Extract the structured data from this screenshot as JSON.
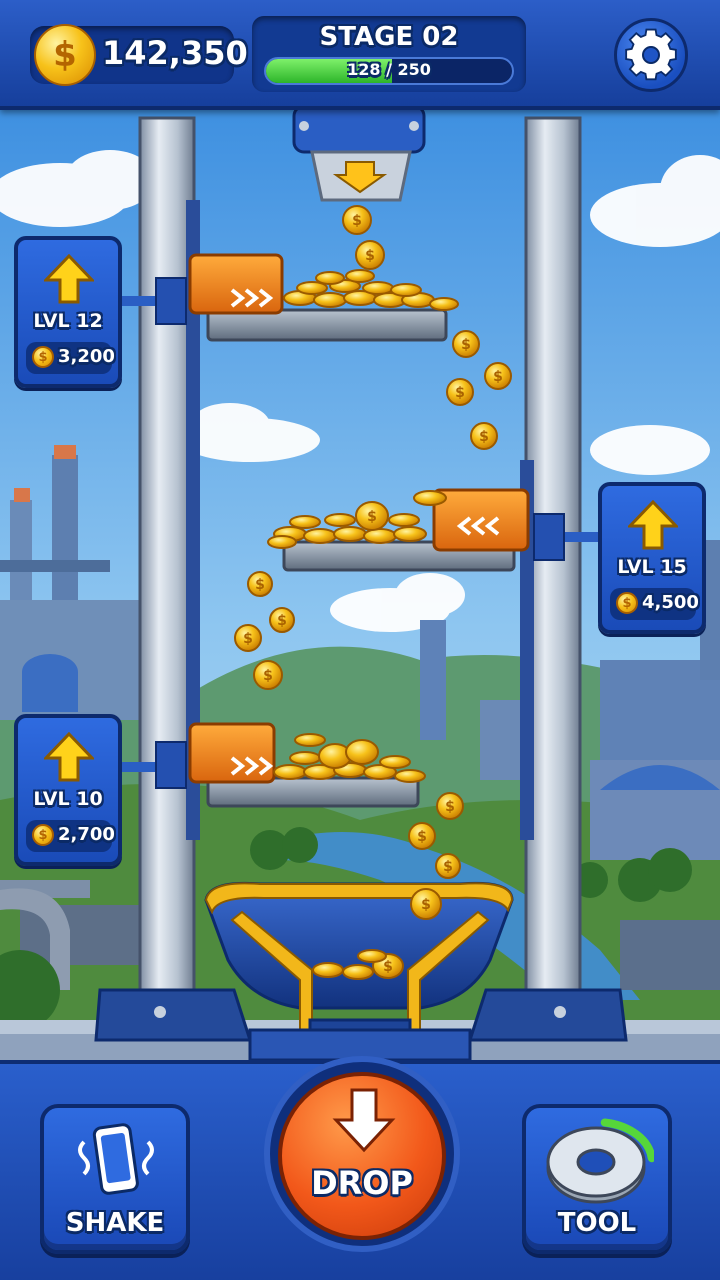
{
  "hud": {
    "coins": "142,350",
    "stage_label": "STAGE 02",
    "progress_text": "128 / 250",
    "progress_value": 128,
    "progress_max": 250,
    "settings_icon": "gear-icon",
    "coin_icon": "dollar-coin-icon"
  },
  "upgrades": [
    {
      "level_text": "LVL 12",
      "cost": "3,200"
    },
    {
      "level_text": "LVL 15",
      "cost": "4,500"
    },
    {
      "level_text": "LVL 10",
      "cost": "2,700"
    }
  ],
  "controls": {
    "shake_label": "SHAKE",
    "drop_label": "DROP",
    "tool_label": "TOOL",
    "shake_icon": "phone-shake-icon",
    "drop_icon": "down-arrow-icon",
    "tool_icon": "washer-ring-icon",
    "tool_charge_fraction": 0.35
  },
  "colors": {
    "hud_blue": "#1f4fb8",
    "progress_green": "#3fd23a",
    "drop_orange": "#f2581a",
    "upgrade_arrow": "#ffd21a",
    "coin_gold": "#f7c21a",
    "pusher_orange": "#f08a1c"
  }
}
